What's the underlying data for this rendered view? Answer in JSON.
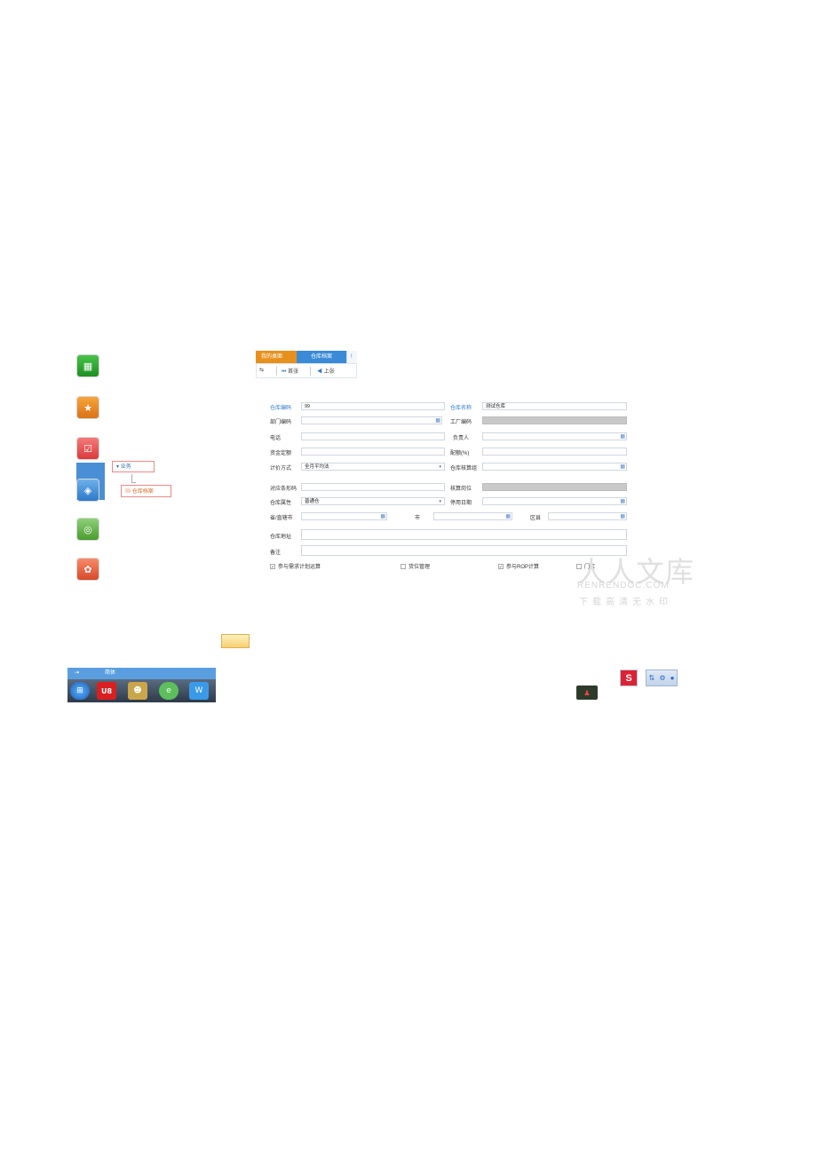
{
  "launcher": {
    "icons": [
      {
        "name": "app-green",
        "glyph": "▦"
      },
      {
        "name": "favorites",
        "glyph": "★"
      },
      {
        "name": "tasks",
        "glyph": "☑"
      },
      {
        "name": "business",
        "glyph": "◈"
      },
      {
        "name": "browser",
        "glyph": "◎"
      },
      {
        "name": "apps",
        "glyph": "✿"
      }
    ]
  },
  "tree": {
    "group_label": "业务",
    "selected_label": "仓库档案"
  },
  "tabs": [
    {
      "label": "我的桌面"
    },
    {
      "label": "仓库档案"
    },
    {
      "label": "!"
    }
  ],
  "toolbar": {
    "btn1": "⇆",
    "btn2": "首张",
    "btn3": "上张"
  },
  "form": {
    "warehouse_code_label": "仓库编码",
    "warehouse_code_value": "99",
    "warehouse_name_label": "仓库名称",
    "warehouse_name_value": "测试仓库",
    "dept_code_label": "部门编码",
    "factory_code_label": "工厂编码",
    "phone_label": "电话",
    "manager_label": "负责人",
    "fund_quota_label": "资金定额",
    "ratio_label": "配额(%)",
    "valuation_label": "计价方式",
    "valuation_value": "全月平均法",
    "accounting_group_label": "仓库核算组",
    "barcode_label": "对应条形码",
    "post_label": "核算岗位",
    "attr_label": "仓库属性",
    "attr_value": "普通仓",
    "disable_date_label": "停用日期",
    "province_label": "省/直辖市",
    "city_label": "市",
    "district_label": "区县",
    "address_label": "仓库地址",
    "remark_label": "备注",
    "chk1_label": "参与需求计划运算",
    "chk2_label": "货位管理",
    "chk3_label": "参与ROP计算",
    "chk4_label": "门店"
  },
  "watermark": {
    "title": "人人文库",
    "domain": "RENRENDOC.COM",
    "slogan": "下载高清无水印"
  },
  "taskbar": {
    "title": "简体",
    "icons": [
      "start",
      "u8",
      "qq-game",
      "browser",
      "wps"
    ],
    "tray_sogou": "S"
  }
}
